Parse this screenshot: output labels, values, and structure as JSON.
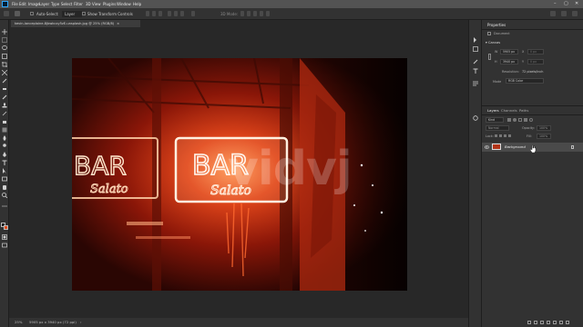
{
  "menubar": {
    "items": [
      "File",
      "Edit",
      "Image",
      "Layer",
      "Type",
      "Select",
      "Filter",
      "3D",
      "View",
      "Plugins",
      "Window",
      "Help"
    ],
    "window_controls": [
      "–",
      "▢",
      "✕"
    ]
  },
  "options_bar": {
    "auto_select": "Auto-Select:",
    "auto_select_value": "Layer",
    "show_transform": "Show Transform Controls",
    "mode_3d": "3D Mode:"
  },
  "document_tab": {
    "title": "kevin-lanceplaine-8jbwkcxy5zE-unsplash.jpg @ 25% (RGB/8)"
  },
  "status_bar": {
    "zoom": "25%",
    "doc_info": "5905 px x 3940 px (72 ppi)"
  },
  "watermark": {
    "text": "vidvj"
  },
  "properties_panel": {
    "title": "Properties",
    "document_label": "Document",
    "canvas_label": "Canvas",
    "w_label": "W",
    "w_value": "5905 px",
    "h_label": "H",
    "h_value": "3940 px",
    "x_placeholder": "0 px",
    "y_placeholder": "0 px",
    "resolution_label": "Resolution:",
    "resolution_value": "72 pixels/inch",
    "mode_label": "Mode",
    "mode_value": "RGB Color"
  },
  "layers_panel": {
    "tabs": [
      "Layers",
      "Channels",
      "Paths"
    ],
    "search_placeholder": "Kind",
    "blend_mode": "Normal",
    "opacity_label": "Opacity:",
    "opacity_value": "100%",
    "lock_label": "Lock:",
    "fill_label": "Fill:",
    "fill_value": "100%",
    "layer_name": "Background"
  },
  "colors": {
    "foreground": "#1a1a1a",
    "background": "#e04a18",
    "ui_panel": "#323232",
    "ui_canvas": "#282828"
  }
}
